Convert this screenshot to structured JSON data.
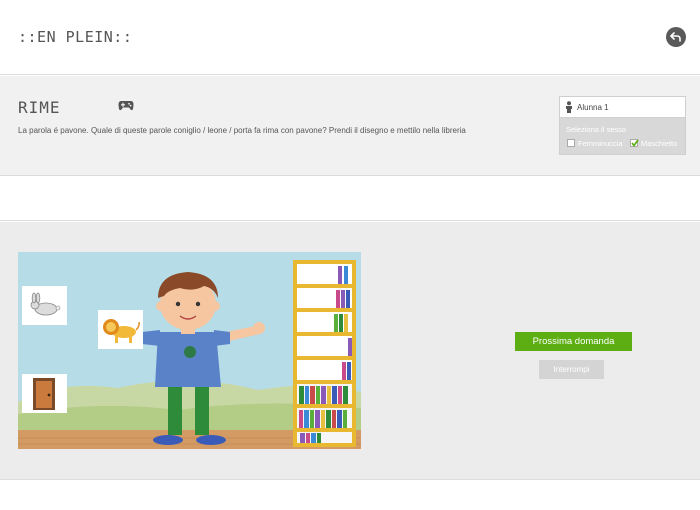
{
  "header": {
    "logo": "::EN PLEIN::",
    "back_icon": "back-arrow-icon"
  },
  "task": {
    "title": "RIME",
    "mode_icon": "gamepad-icon",
    "question": "La parola é pavone. Quale di queste parole coniglio / leone / porta fa rima con pavone? Prendi il disegno e mettilo nella libreria"
  },
  "student": {
    "icon": "person-icon",
    "name": "Alunna 1",
    "gender_label": "Seleziona il sesso",
    "options": [
      {
        "label": "Femminuccia",
        "checked": false
      },
      {
        "label": "Maschietto",
        "checked": true
      }
    ]
  },
  "game": {
    "cards": [
      "rabbit-card",
      "lion-card",
      "door-card"
    ]
  },
  "actions": {
    "next_label": "Prossima domanda",
    "stop_label": "Interrompi"
  },
  "colors": {
    "accent": "#5cae12",
    "panel": "#d8d8d8",
    "sky": "#b6dce8",
    "bookshelf": "#e8b830"
  }
}
